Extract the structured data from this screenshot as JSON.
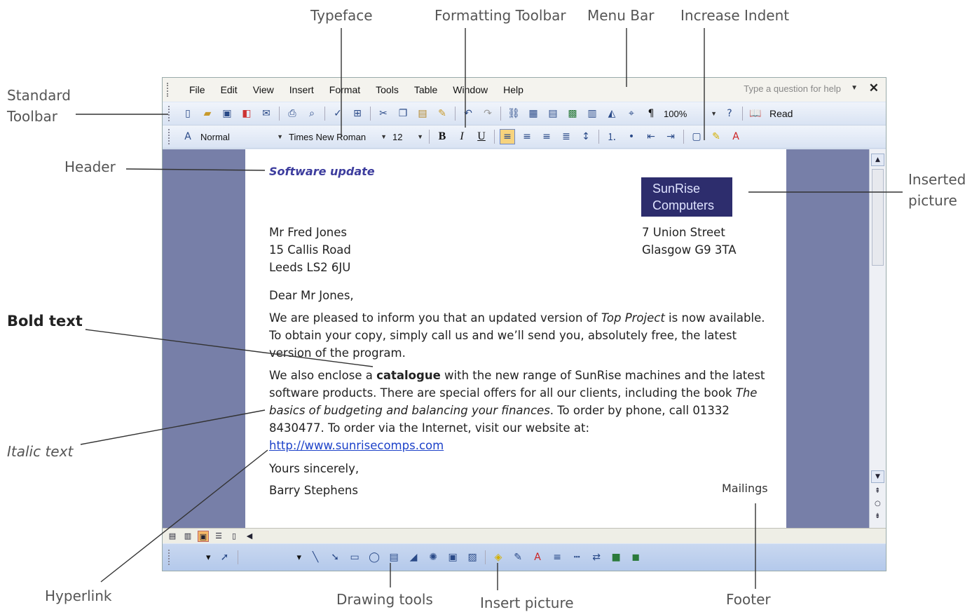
{
  "callouts": {
    "typeface": "Typeface",
    "formatting_toolbar": "Formatting Toolbar",
    "menu_bar": "Menu Bar",
    "increase_indent": "Increase Indent",
    "standard_toolbar_1": "Standard",
    "standard_toolbar_2": "Toolbar",
    "header": "Header",
    "inserted_picture_1": "Inserted",
    "inserted_picture_2": "picture",
    "bold_text": "Bold text",
    "italic_text": "Italic text",
    "hyperlink": "Hyperlink",
    "drawing_tools": "Drawing tools",
    "insert_picture": "Insert picture",
    "footer": "Footer"
  },
  "menubar": {
    "items": [
      "File",
      "Edit",
      "View",
      "Insert",
      "Format",
      "Tools",
      "Table",
      "Window",
      "Help"
    ],
    "help_placeholder": "Type a question for help"
  },
  "standard_toolbar": {
    "zoom": "100%",
    "read_label": "Read"
  },
  "formatting_toolbar": {
    "style": "Normal",
    "font": "Times New Roman",
    "size": "12",
    "bold": "B",
    "italic": "I",
    "underline": "U"
  },
  "document": {
    "header": "Software update",
    "logo_line1": "SunRise",
    "logo_line2": "Computers",
    "recipient": [
      "Mr Fred Jones",
      "15 Callis Road",
      "Leeds LS2 6JU"
    ],
    "sender": [
      "7 Union Street",
      "Glasgow G9 3TA"
    ],
    "greeting": "Dear Mr Jones,",
    "p1_a": "We are pleased to inform you that an updated version of ",
    "p1_em": "Top Project",
    "p1_b": " is now available. To obtain your copy, simply call us and we’ll send you, absolutely free, the latest version of the program.",
    "p2_a": "We also enclose a ",
    "p2_strong": "catalogue",
    "p2_b": " with the new range of SunRise machines and the latest software products. There are special offers for all our clients, including the book ",
    "p2_em": "The basics of budgeting and balancing your finances",
    "p2_c": ". To order by phone, call 01332 8430477. To order via the Internet, visit our website at:",
    "link": "http://www.sunrisecomps.com",
    "closing": "Yours sincerely,",
    "signature": "Barry Stephens",
    "footer_text": "Mailings"
  }
}
